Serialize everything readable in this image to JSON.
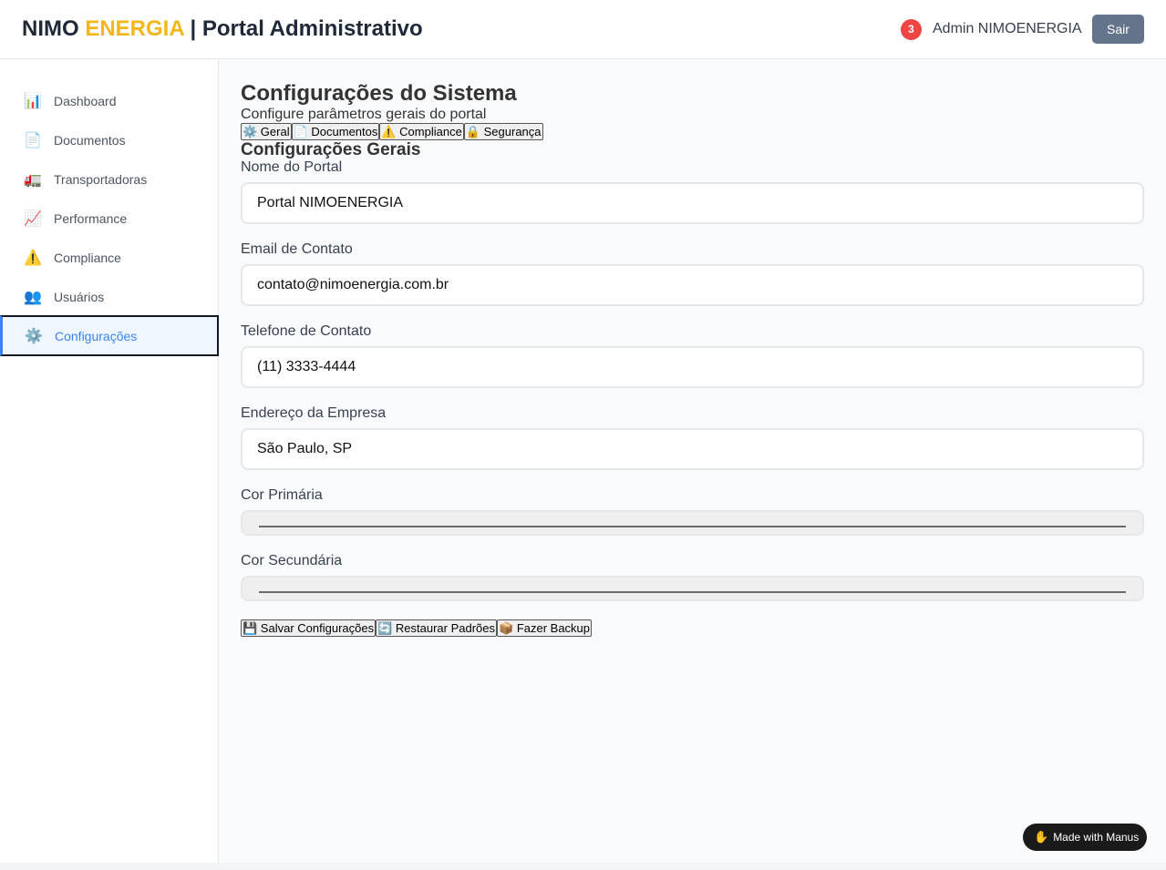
{
  "header": {
    "brand_part1": "NIMO ",
    "brand_accent": "ENERGIA",
    "brand_part2": " | Portal Administrativo",
    "notification_count": "3",
    "user_name": "Admin NIMOENERGIA",
    "logout_label": "Sair"
  },
  "sidebar": {
    "items": [
      {
        "icon": "📊",
        "icon_name": "bar-chart-icon",
        "label": "Dashboard"
      },
      {
        "icon": "📄",
        "icon_name": "document-icon",
        "label": "Documentos"
      },
      {
        "icon": "🚛",
        "icon_name": "truck-icon",
        "label": "Transportadoras"
      },
      {
        "icon": "📈",
        "icon_name": "trend-up-icon",
        "label": "Performance"
      },
      {
        "icon": "⚠️",
        "icon_name": "warning-icon",
        "label": "Compliance"
      },
      {
        "icon": "👥",
        "icon_name": "users-icon",
        "label": "Usuários"
      },
      {
        "icon": "⚙️",
        "icon_name": "gear-icon",
        "label": "Configurações"
      }
    ],
    "active_index": 6
  },
  "main": {
    "title": "Configurações do Sistema",
    "subtitle": "Configure parâmetros gerais do portal",
    "tabs": [
      {
        "label": "⚙️ Geral"
      },
      {
        "label": "📄 Documentos"
      },
      {
        "label": "⚠️ Compliance"
      },
      {
        "label": "🔒 Segurança"
      }
    ],
    "section_title": "Configurações Gerais",
    "fields": {
      "portal_name": {
        "label": "Nome do Portal",
        "value": "Portal NIMOENERGIA"
      },
      "contact_email": {
        "label": "Email de Contato",
        "value": "contato@nimoenergia.com.br"
      },
      "contact_phone": {
        "label": "Telefone de Contato",
        "value": "(11) 3333-4444"
      },
      "company_address": {
        "label": "Endereço da Empresa",
        "value": "São Paulo, SP"
      },
      "primary_color": {
        "label": "Cor Primária"
      },
      "secondary_color": {
        "label": "Cor Secundária"
      }
    },
    "actions": {
      "save": "💾 Salvar Configurações",
      "restore": "🔄 Restaurar Padrões",
      "backup": "📦 Fazer Backup"
    }
  },
  "badge": {
    "icon": "✋",
    "label": "Made with Manus"
  },
  "colors": {
    "brand_accent": "#f4b61a",
    "active_nav": "#3b82f6",
    "notification": "#ef4444",
    "logout_button": "#64748b"
  }
}
